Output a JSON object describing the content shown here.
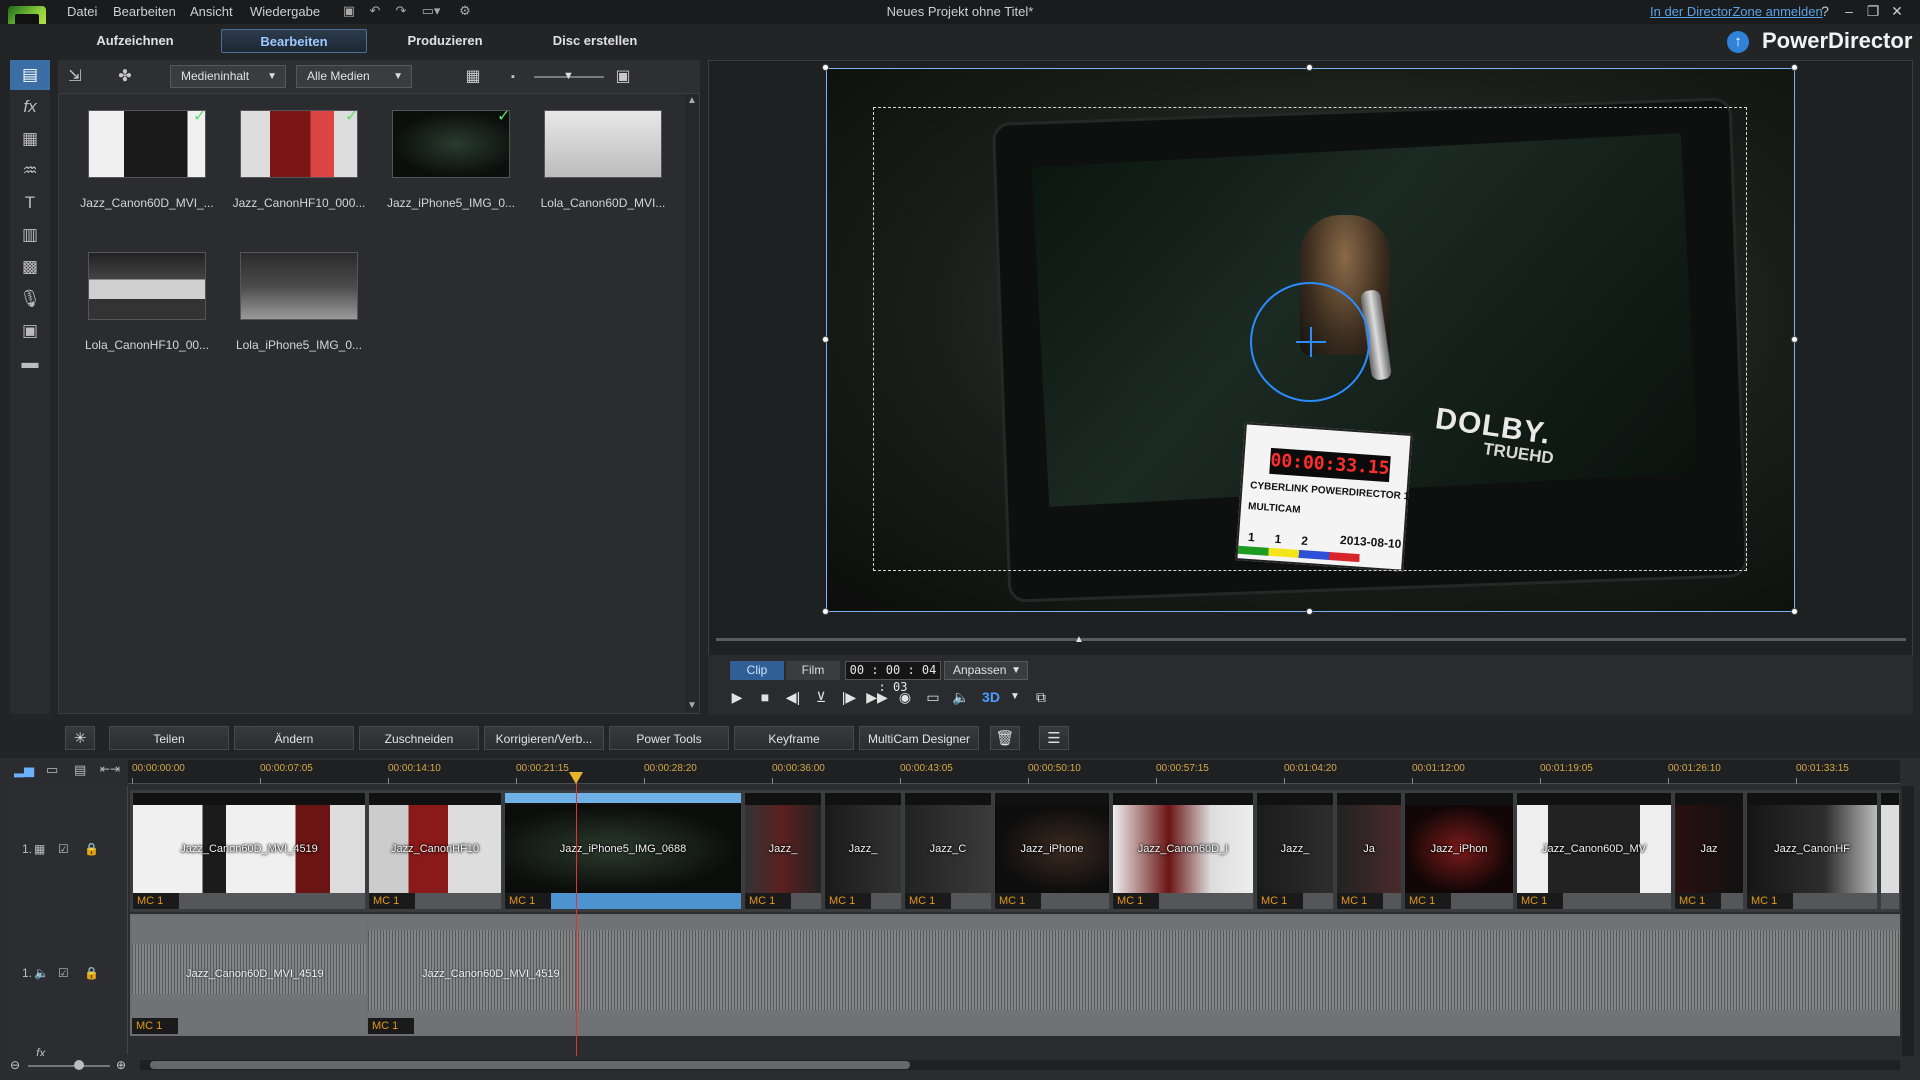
{
  "menu": {
    "items": [
      "Datei",
      "Bearbeiten",
      "Ansicht",
      "Wiedergabe"
    ],
    "title": "Neues Projekt ohne Titel*",
    "directorzone": "In der DirectorZone anmelden",
    "help": "?",
    "minimize": "–",
    "restore": "❐",
    "close": "✕"
  },
  "modes": {
    "capture": "Aufzeichnen",
    "edit": "Bearbeiten",
    "produce": "Produzieren",
    "disc": "Disc erstellen",
    "brand": "PowerDirector"
  },
  "library": {
    "filter_content": "Medieninhalt",
    "filter_media": "Alle Medien",
    "items": [
      {
        "label": "Jazz_Canon60D_MVI_...",
        "checked": true
      },
      {
        "label": "Jazz_CanonHF10_000...",
        "checked": true
      },
      {
        "label": "Jazz_iPhone5_IMG_0...",
        "checked": true
      },
      {
        "label": "Lola_Canon60D_MVI...",
        "checked": false
      },
      {
        "label": "Lola_CanonHF10_00...",
        "checked": false
      },
      {
        "label": "Lola_iPhone5_IMG_0...",
        "checked": false
      }
    ]
  },
  "preview": {
    "clapper_time": "00:00:33.15",
    "clapper_title": "CYBERLINK POWERDIRECTOR 12",
    "clapper_multicam": "MULTICAM",
    "clapper_nums": "1      1      2",
    "clapper_date": "2013-08-10",
    "logo_dolby": "DOLBY.",
    "logo_truehd": "TRUEHD"
  },
  "playback": {
    "tab_clip": "Clip",
    "tab_film": "Film",
    "timecode": "00 : 00 : 04 : 03",
    "fit": "Anpassen",
    "three_d": "3D"
  },
  "edit_toolbar": {
    "split": "Teilen",
    "modify": "Ändern",
    "trim": "Zuschneiden",
    "fix": "Korrigieren/Verb...",
    "power_tools": "Power Tools",
    "keyframe": "Keyframe",
    "multicam": "MultiCam Designer"
  },
  "timeline": {
    "ruler": [
      "00:00:00:00",
      "00:00:07:05",
      "00:00:14:10",
      "00:00:21:15",
      "00:00:28:20",
      "00:00:36:00",
      "00:00:43:05",
      "00:00:50:10",
      "00:00:57:15",
      "00:01:04:20",
      "00:01:12:00",
      "00:01:19:05",
      "00:01:26:10",
      "00:01:33:15"
    ],
    "track_video_num": "1.",
    "track_audio_num": "1.",
    "mc_label": "MC 1",
    "video_clips": [
      {
        "name": "Jazz_Canon60D_MVI_4519"
      },
      {
        "name": "Jazz_CanonHF10"
      },
      {
        "name": "Jazz_iPhone5_IMG_0688"
      },
      {
        "name": "Jazz_"
      },
      {
        "name": "Jazz_"
      },
      {
        "name": "Jazz_C"
      },
      {
        "name": "Jazz_iPhone"
      },
      {
        "name": "Jazz_Canon60D_I"
      },
      {
        "name": "Jazz_"
      },
      {
        "name": "Ja"
      },
      {
        "name": "Jazz_iPhon"
      },
      {
        "name": "Jazz_Canon60D_MV"
      },
      {
        "name": "Jaz"
      },
      {
        "name": "Jazz_CanonHF"
      },
      {
        "name": ""
      }
    ],
    "audio_clips": [
      {
        "name": "Jazz_Canon60D_MVI_4519"
      },
      {
        "name": "Jazz_Canon60D_MVI_4519"
      }
    ]
  }
}
